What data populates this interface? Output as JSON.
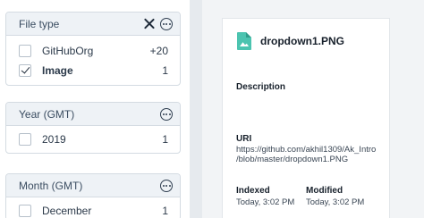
{
  "facets": [
    {
      "title": "File type",
      "rows": [
        {
          "label": "GitHubOrg",
          "count": "+20",
          "checked": false
        },
        {
          "label": "Image",
          "count": "1",
          "checked": true
        }
      ]
    },
    {
      "title": "Year (GMT)",
      "rows": [
        {
          "label": "2019",
          "count": "1",
          "checked": false
        }
      ]
    },
    {
      "title": "Month (GMT)",
      "rows": [
        {
          "label": "December",
          "count": "1",
          "checked": false
        }
      ]
    }
  ],
  "detail": {
    "file_name": "dropdown1.PNG",
    "description_label": "Description",
    "uri_label": "URI",
    "uri_line1": "https://github.com/akhil1309/Ak_Intro",
    "uri_line2": "/blob/master/dropdown1.PNG",
    "indexed_label": "Indexed",
    "indexed_value": "Today, 3:02 PM",
    "modified_label": "Modified",
    "modified_value": "Today, 3:02 PM"
  },
  "colors": {
    "file_icon": "#4cc4b0",
    "facet_header_bg": "#eef2f6",
    "panel_bg": "#f2f4f6"
  }
}
